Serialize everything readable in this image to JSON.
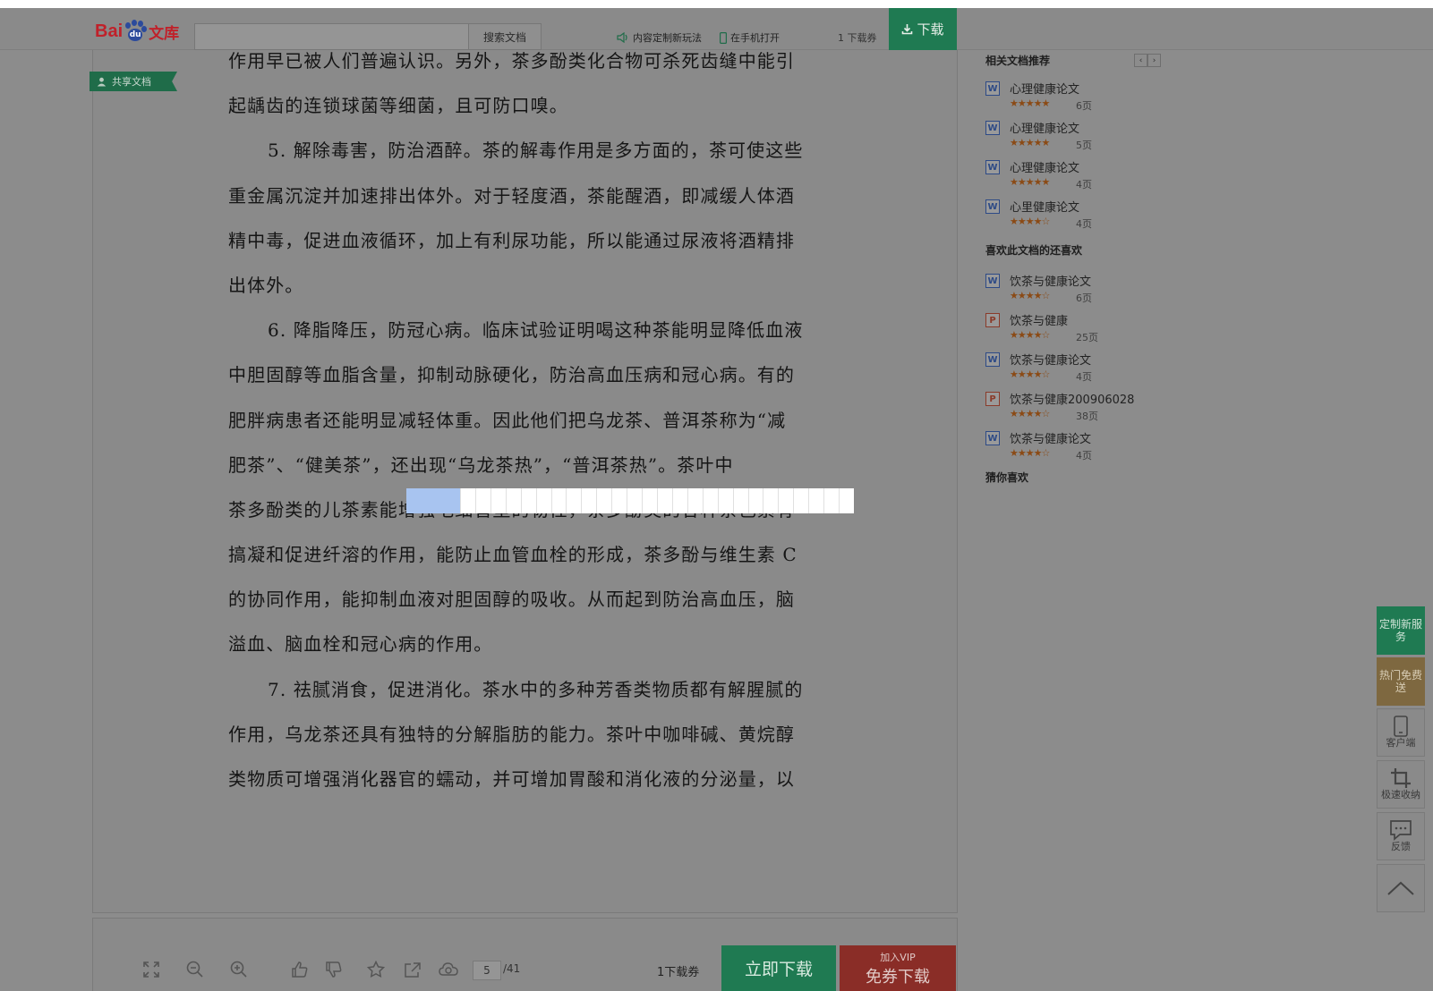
{
  "header": {
    "logo_bai": "Bai",
    "logo_du": "du",
    "logo_wenku": "文库",
    "search_button": "搜索文档",
    "link_custom": "内容定制新玩法",
    "link_mobile": "在手机打开",
    "coupon_text": "1 下载券",
    "download_label": "下载"
  },
  "ribbon": {
    "label": "共享文档"
  },
  "document": {
    "lines": [
      {
        "text": "作用早已被人们普遍认识。另外，茶多酚类化合物可杀死齿缝中能引",
        "indent": false
      },
      {
        "text": "起龋齿的连锁球菌等细菌，且可防口嗅。",
        "indent": false
      },
      {
        "text": "5. 解除毒害，防治酒醉。茶的解毒作用是多方面的，茶可使这些",
        "indent": true
      },
      {
        "text": "重金属沉淀并加速排出体外。对于轻度酒，茶能醒酒，即减缓人体酒",
        "indent": false
      },
      {
        "text": "精中毒，促进血液循环，加上有利尿功能，所以能通过尿液将酒精排",
        "indent": false
      },
      {
        "text": "出体外。",
        "indent": false
      },
      {
        "text": "6. 降脂降压，防冠心病。临床试验证明喝这种茶能明显降低血液",
        "indent": true
      },
      {
        "text": "中胆固醇等血脂含量，抑制动脉硬化，防治高血压病和冠心病。有的",
        "indent": false
      },
      {
        "text": "肥胖病患者还能明显减轻体重。因此他们把乌龙茶、普洱茶称为“减",
        "indent": false
      },
      {
        "text": "肥茶”、“健美茶”，还出现“乌龙茶热”，“普洱茶热”。茶叶中",
        "indent": false
      },
      {
        "text": "茶多酚类的儿茶素能增强毛细管壁的韧性，茶多酚类的各种茶色素有",
        "indent": false
      },
      {
        "text": "搞凝和促进纤溶的作用，能防止血管血栓的形成，茶多酚与维生素 C",
        "indent": false
      },
      {
        "text": "的协同作用，能抑制血液对胆固醇的吸收。从而起到防治高血压，脑",
        "indent": false
      },
      {
        "text": "溢血、脑血栓和冠心病的作用。",
        "indent": false
      },
      {
        "text": "7. 祛腻消食，促进消化。茶水中的多种芳香类物质都有解腥腻的",
        "indent": true
      },
      {
        "text": "作用，乌龙茶还具有独特的分解脂肪的能力。茶叶中咖啡碱、黄烷醇",
        "indent": false
      },
      {
        "text": "类物质可增强消化器官的蠕动，并可增加胃酸和消化液的分泌量，以",
        "indent": false
      }
    ]
  },
  "bottom_toolbar": {
    "page_current": "5",
    "page_total": "/41",
    "coupon_text": "1下载券",
    "download_now": "立即下载",
    "vip_top": "加入VIP",
    "vip_bottom": "免券下载"
  },
  "sidebar": {
    "related_title": "相关文档推荐",
    "related": [
      {
        "type": "W",
        "title": "心理健康论文",
        "stars": "★★★★★",
        "pages": "6页"
      },
      {
        "type": "W",
        "title": "心理健康论文",
        "stars": "★★★★★",
        "pages": "5页"
      },
      {
        "type": "W",
        "title": "心理健康论文",
        "stars": "★★★★★",
        "pages": "4页"
      },
      {
        "type": "W",
        "title": "心里健康论文",
        "stars": "★★★★☆",
        "pages": "4页"
      }
    ],
    "liked_title": "喜欢此文档的还喜欢",
    "liked": [
      {
        "type": "W",
        "title": "饮茶与健康论文",
        "stars": "★★★★☆",
        "pages": "6页"
      },
      {
        "type": "P",
        "title": "饮茶与健康",
        "stars": "★★★★☆",
        "pages": "25页"
      },
      {
        "type": "W",
        "title": "饮茶与健康论文",
        "stars": "★★★★☆",
        "pages": "4页"
      },
      {
        "type": "P",
        "title": "饮茶与健康200906028",
        "stars": "★★★★☆",
        "pages": "38页"
      },
      {
        "type": "W",
        "title": "饮茶与健康论文",
        "stars": "★★★★☆",
        "pages": "4页"
      }
    ],
    "guess_title": "猜你喜欢"
  },
  "right_rail": {
    "custom": "定制新服务",
    "hot": "热门免费送",
    "client": "客户端",
    "collect": "极速收纳",
    "feedback": "反馈"
  }
}
